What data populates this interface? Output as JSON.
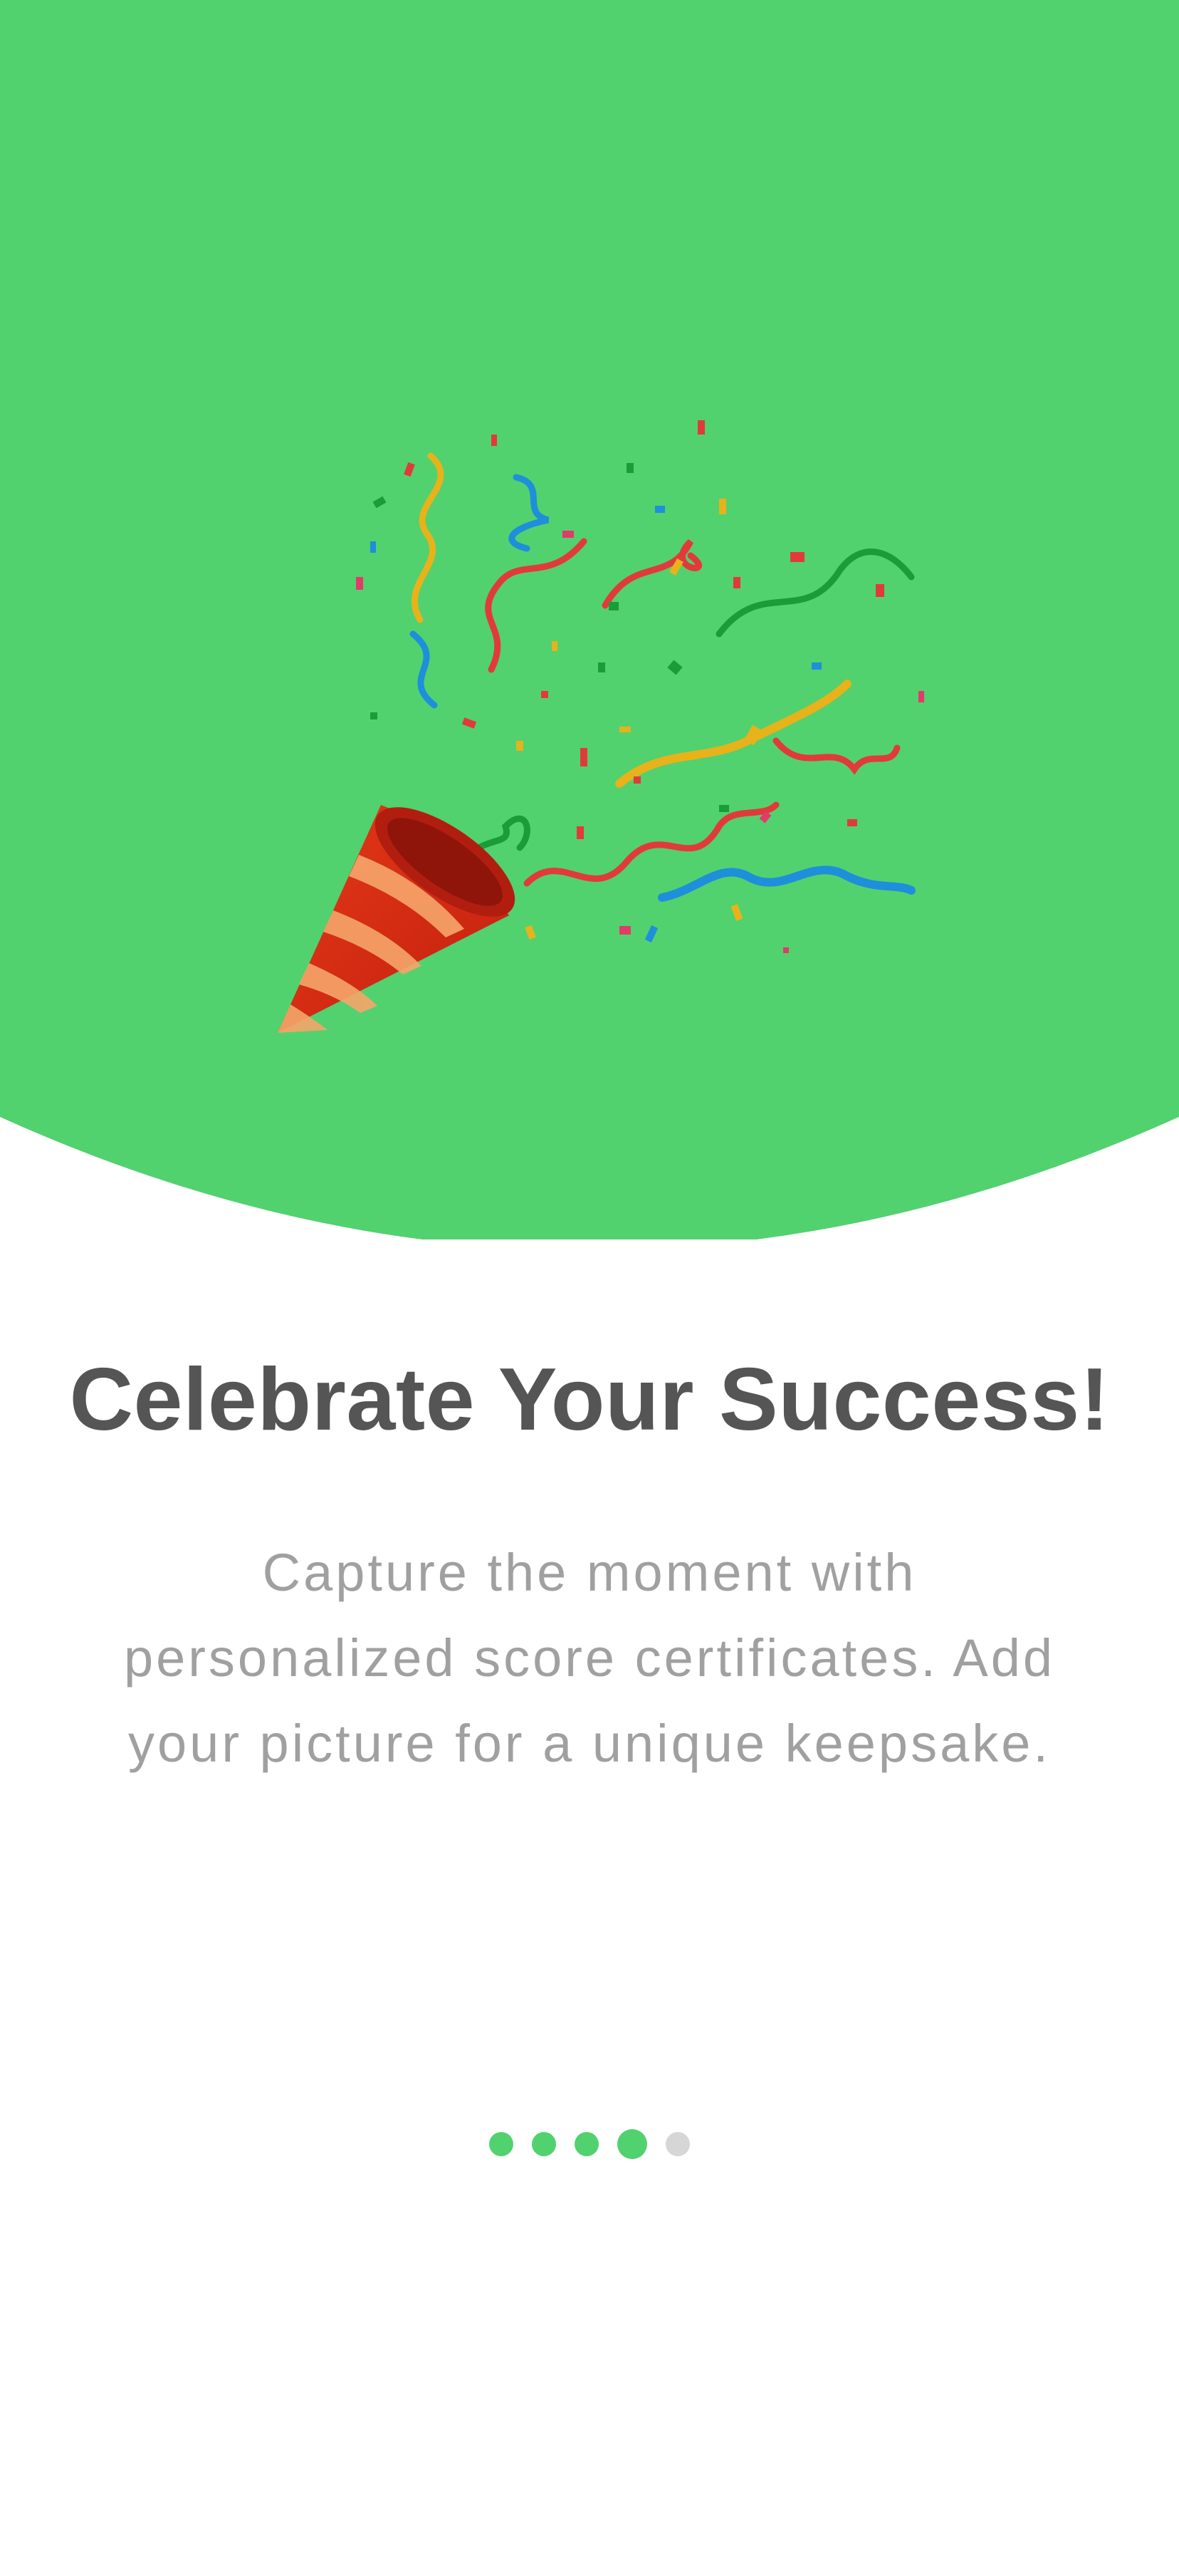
{
  "colors": {
    "hero_background": "#52d16f",
    "title_text": "#555555",
    "description_text": "#a0a0a0",
    "indicator_active": "#52d16f",
    "indicator_inactive": "#d6d6d6"
  },
  "hero": {
    "illustration_icon": "party-popper-icon"
  },
  "onboarding": {
    "title": "Celebrate Your Success!",
    "description_lines": [
      "Capture the moment with",
      "personalized score certificates. Add",
      "your picture for a unique keepsake."
    ]
  },
  "pager": {
    "total_pages": 5,
    "current_page": 4
  }
}
